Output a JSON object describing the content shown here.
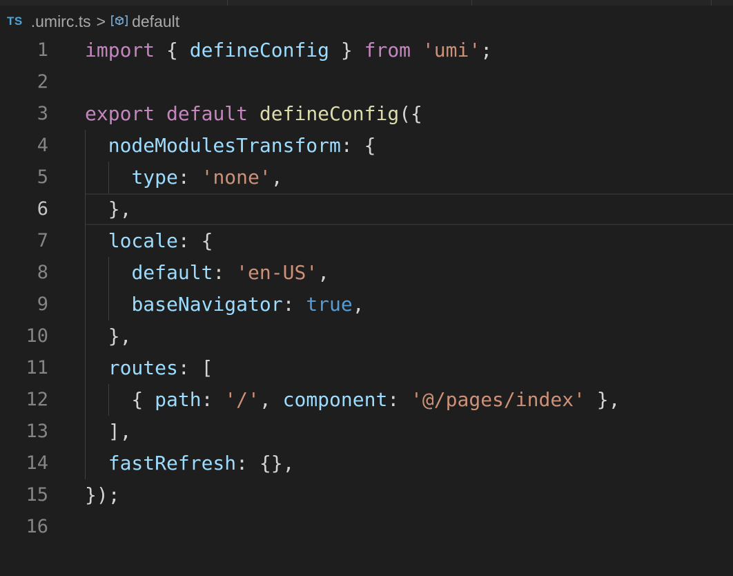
{
  "breadcrumb": {
    "file_icon": "TS",
    "file_name": ".umirc.ts",
    "separator": ">",
    "symbol_icon": "symbol-module-icon",
    "symbol_name": "default"
  },
  "editor": {
    "current_line": 6,
    "colors": {
      "background": "#1e1e1e",
      "keyword": "#c586c0",
      "function": "#dcdcaa",
      "variable": "#9cdcfe",
      "string": "#ce9178",
      "boolean": "#569cd6",
      "punctuation": "#d4d4d4"
    },
    "line_numbers": [
      "1",
      "2",
      "3",
      "4",
      "5",
      "6",
      "7",
      "8",
      "9",
      "10",
      "11",
      "12",
      "13",
      "14",
      "15",
      "16"
    ],
    "lines": [
      [
        [
          "kw",
          "import"
        ],
        [
          "pun",
          " { "
        ],
        [
          "var",
          "defineConfig"
        ],
        [
          "pun",
          " } "
        ],
        [
          "kw",
          "from"
        ],
        [
          "pun",
          " "
        ],
        [
          "str",
          "'umi'"
        ],
        [
          "pun",
          ";"
        ]
      ],
      [],
      [
        [
          "kw",
          "export"
        ],
        [
          "pun",
          " "
        ],
        [
          "kw",
          "default"
        ],
        [
          "pun",
          " "
        ],
        [
          "fn",
          "defineConfig"
        ],
        [
          "pun",
          "({"
        ]
      ],
      [
        [
          "pun",
          "  "
        ],
        [
          "var",
          "nodeModulesTransform"
        ],
        [
          "pun",
          ": {"
        ]
      ],
      [
        [
          "pun",
          "    "
        ],
        [
          "var",
          "type"
        ],
        [
          "pun",
          ": "
        ],
        [
          "str",
          "'none'"
        ],
        [
          "pun",
          ","
        ]
      ],
      [
        [
          "pun",
          "  },"
        ]
      ],
      [
        [
          "pun",
          "  "
        ],
        [
          "var",
          "locale"
        ],
        [
          "pun",
          ": {"
        ]
      ],
      [
        [
          "pun",
          "    "
        ],
        [
          "var",
          "default"
        ],
        [
          "pun",
          ": "
        ],
        [
          "str",
          "'en-US'"
        ],
        [
          "pun",
          ","
        ]
      ],
      [
        [
          "pun",
          "    "
        ],
        [
          "var",
          "baseNavigator"
        ],
        [
          "pun",
          ": "
        ],
        [
          "bool",
          "true"
        ],
        [
          "pun",
          ","
        ]
      ],
      [
        [
          "pun",
          "  },"
        ]
      ],
      [
        [
          "pun",
          "  "
        ],
        [
          "var",
          "routes"
        ],
        [
          "pun",
          ": ["
        ]
      ],
      [
        [
          "pun",
          "    { "
        ],
        [
          "var",
          "path"
        ],
        [
          "pun",
          ": "
        ],
        [
          "str",
          "'/'"
        ],
        [
          "pun",
          ", "
        ],
        [
          "var",
          "component"
        ],
        [
          "pun",
          ": "
        ],
        [
          "str",
          "'@/pages/index'"
        ],
        [
          "pun",
          " },"
        ]
      ],
      [
        [
          "pun",
          "  ],"
        ]
      ],
      [
        [
          "pun",
          "  "
        ],
        [
          "var",
          "fastRefresh"
        ],
        [
          "pun",
          ": {},"
        ]
      ],
      [
        [
          "pun",
          "});"
        ]
      ],
      []
    ]
  }
}
